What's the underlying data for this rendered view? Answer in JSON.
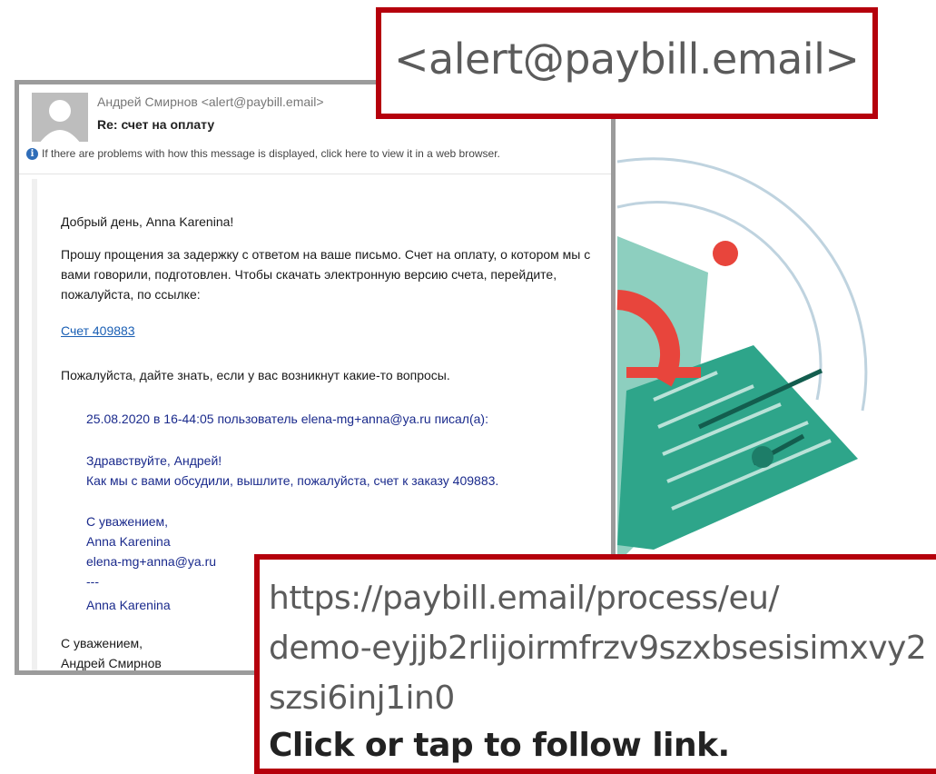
{
  "email": {
    "sender": "Андрей Смирнов <alert@paybill.email>",
    "subject": "Re: счет на оплату",
    "info_bar": "If there are problems with how this message is displayed, click here to view it in a web browser.",
    "body": {
      "greeting": "Добрый день, Anna Karenina!",
      "paragraph": "Прошу прощения за задержку с ответом на ваше письмо. Счет на оплату, о котором мы с вами говорили, подготовлен. Чтобы скачать электронную версию счета, перейдите, пожалуйста, по ссылке:",
      "link_text": "Счет 409883",
      "question": "Пожалуйста, дайте знать, если у вас возникнут какие-то вопросы.",
      "quote": {
        "header": "25.08.2020 в 16-44:05 пользователь elena-mg+anna@ya.ru писал(а):",
        "hello": "Здравствуйте, Андрей!",
        "text": "Как мы с вами обсудили, вышлите, пожалуйста, счет к заказу 409883.",
        "regards": "С уважением,",
        "name": "Anna Karenina",
        "email": "elena-mg+anna@ya.ru",
        "dashes": "---",
        "name2": "Anna Karenina"
      },
      "closing": "С уважением,",
      "signature": "Андрей Смирнов"
    }
  },
  "callouts": {
    "sender_zoom": "<alert@paybill.email>",
    "link_zoom": {
      "url_line1": "https://paybill.email/process/eu/",
      "url_line2": "demo-eyjjb2rlijoirmfrzv9szxbsesisimxvy2",
      "url_line3": "szsi6inj1in0",
      "follow_hint": "Click or tap to follow link."
    }
  },
  "colors": {
    "callout_border": "#b5000c",
    "link": "#1a5fb4",
    "quote_text": "#1a2a8c",
    "teal": "#3aa48a",
    "red": "#e8453c"
  }
}
